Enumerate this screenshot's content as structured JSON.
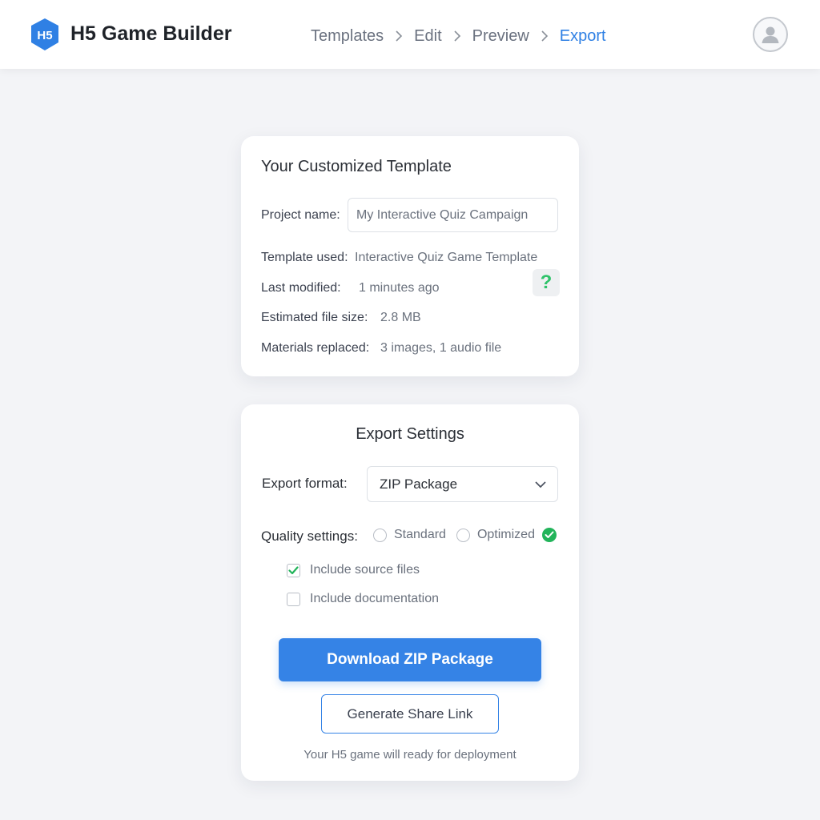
{
  "header": {
    "logo_text": "H5",
    "app_name": "H5 Game Builder",
    "breadcrumbs": [
      {
        "label": "Templates",
        "active": false
      },
      {
        "label": "Edit",
        "active": false
      },
      {
        "label": "Preview",
        "active": false
      },
      {
        "label": "Export",
        "active": true
      }
    ]
  },
  "summary": {
    "title": "Your Customized Template",
    "project_name_label": "Project name:",
    "project_name_value": "My Interactive Quiz Campaign",
    "template_used_label": "Template used:",
    "template_used_value": "Interactive Quiz Game Template",
    "last_modified_label": "Last modified:",
    "last_modified_value": "1 minutes ago",
    "file_size_label": "Estimated file size:",
    "file_size_value": "2.8 MB",
    "materials_label": "Materials replaced:",
    "materials_value": "3 images, 1 audio file",
    "help_icon_glyph": "?"
  },
  "export": {
    "title": "Export Settings",
    "format_label": "Export format:",
    "format_value": "ZIP Package",
    "quality_label": "Quality settings:",
    "quality_options": [
      {
        "label": "Standard",
        "selected": false
      },
      {
        "label": "Optimized",
        "selected": true
      }
    ],
    "checkboxes": [
      {
        "label": "Include source files",
        "checked": true
      },
      {
        "label": "Include documentation",
        "checked": false
      }
    ],
    "download_label": "Download ZIP Package",
    "share_label": "Generate Share Link",
    "footnote": "Your H5 game will ready for deployment"
  },
  "colors": {
    "accent": "#3583e6",
    "success": "#22b45a",
    "background": "#f3f4f7"
  }
}
